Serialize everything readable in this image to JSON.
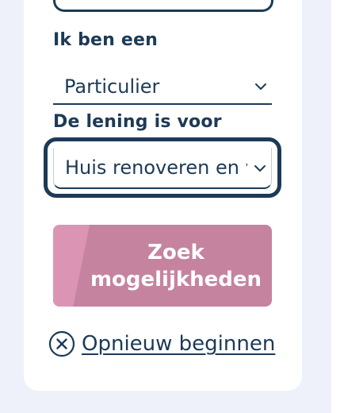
{
  "form": {
    "type_label": "Ik ben een",
    "type_value": "Particulier",
    "purpose_label": "De lening is voor",
    "purpose_value": "Huis renoveren en verbouwen",
    "submit_label": "Zoek mogelijkheden",
    "reset_label": "Opnieuw beginnen"
  },
  "icons": {
    "select_chevron": "chevron-down-icon",
    "reset_icon": "close-circle-icon"
  },
  "colors": {
    "navy": "#1d3a56",
    "button_pink": "#c5839f",
    "button_accent": "#dc94b5",
    "background": "#eef1f9"
  }
}
